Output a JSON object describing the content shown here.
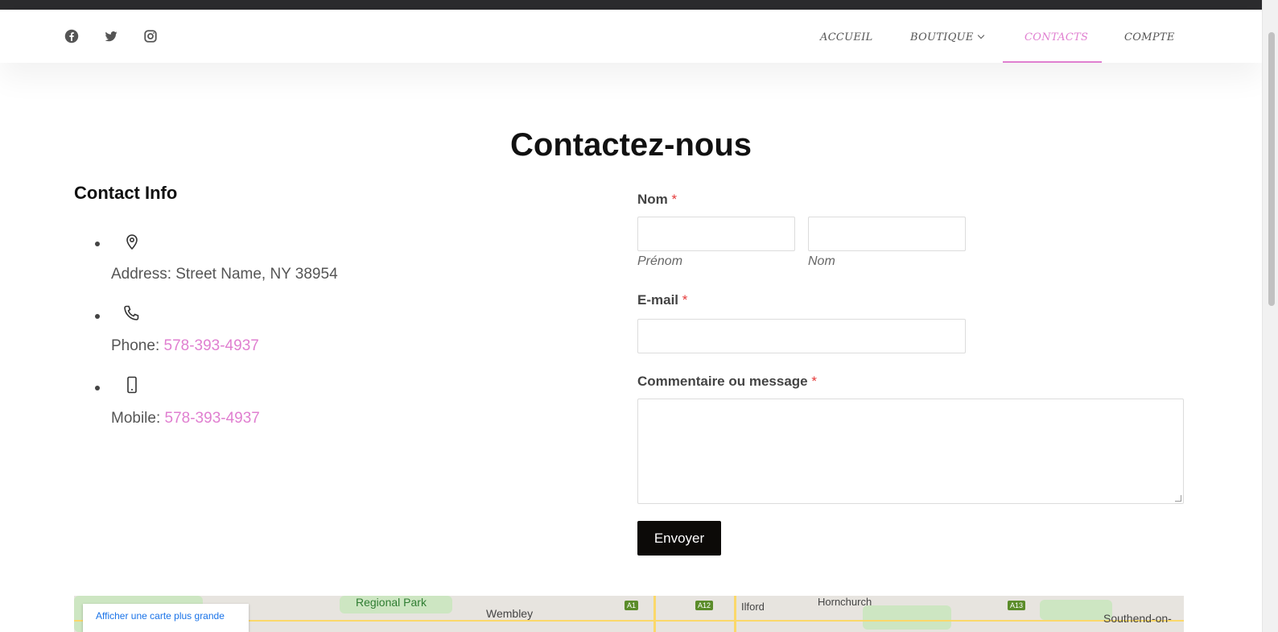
{
  "header": {
    "social": [
      "facebook-icon",
      "twitter-icon",
      "instagram-icon"
    ],
    "nav": [
      {
        "label": "ACCUEIL"
      },
      {
        "label": "BOUTIQUE"
      },
      {
        "label": "CONTACTS",
        "active": true
      },
      {
        "label": "COMPTE"
      }
    ]
  },
  "page": {
    "title": "Contactez-nous"
  },
  "contact_info": {
    "heading": "Contact Info",
    "items": [
      {
        "icon": "location-pin-icon",
        "prefix": "Address: Street Name, NY 38954",
        "link": ""
      },
      {
        "icon": "phone-icon",
        "prefix": "Phone: ",
        "link": "578-393-4937"
      },
      {
        "icon": "mobile-icon",
        "prefix": "Mobile: ",
        "link": "578-393-4937"
      }
    ]
  },
  "form": {
    "name_label": "Nom",
    "required_mark": "*",
    "first_name_sublabel": "Prénom",
    "last_name_sublabel": "Nom",
    "email_label": "E-mail",
    "message_label": "Commentaire ou message",
    "submit_label": "Envoyer",
    "first_name_value": "",
    "last_name_value": "",
    "email_value": "",
    "message_value": ""
  },
  "map": {
    "larger_map_link": "Afficher une carte plus grande",
    "places": [
      "Regional Park",
      "Wembley",
      "Ilford",
      "Hornchurch",
      "Southend-on-"
    ],
    "roads": [
      "A1",
      "A12",
      "A13"
    ]
  },
  "colors": {
    "accent": "#e07fd0",
    "required": "#e53a3a",
    "button": "#0c0a08",
    "topbar": "#2b2b2d"
  }
}
